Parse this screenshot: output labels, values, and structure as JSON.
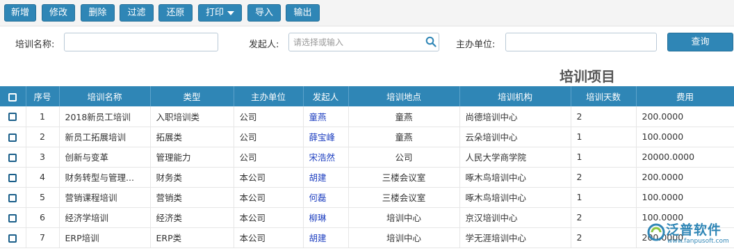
{
  "toolbar": {
    "buttons": [
      "新增",
      "修改",
      "删除",
      "过滤",
      "还原",
      "打印",
      "导入",
      "输出"
    ]
  },
  "filters": {
    "name_label": "培训名称:",
    "name_value": "",
    "initiator_label": "发起人:",
    "initiator_placeholder": "请选择或输入",
    "org_label": "主办单位:",
    "org_value": "",
    "query_label": "查询"
  },
  "title": "培训项目",
  "table": {
    "columns": [
      "序号",
      "培训名称",
      "类型",
      "主办单位",
      "发起人",
      "培训地点",
      "培训机构",
      "培训天数",
      "费用"
    ],
    "rows": [
      {
        "no": "1",
        "name": "2018新员工培训",
        "type": "入职培训类",
        "org": "公司",
        "initiator": "童燕",
        "place": "童燕",
        "agency": "尚德培训中心",
        "days": "2",
        "fee": "200.0000"
      },
      {
        "no": "2",
        "name": "新员工拓展培训",
        "type": "拓展类",
        "org": "公司",
        "initiator": "薛宝峰",
        "place": "童燕",
        "agency": "云朵培训中心",
        "days": "1",
        "fee": "100.0000"
      },
      {
        "no": "3",
        "name": "创新与变革",
        "type": "管理能力",
        "org": "公司",
        "initiator": "宋浩然",
        "place": "公司",
        "agency": "人民大学商学院",
        "days": "1",
        "fee": "20000.0000"
      },
      {
        "no": "4",
        "name": "财务转型与管理...",
        "type": "财务类",
        "org": "本公司",
        "initiator": "胡建",
        "place": "三楼会议室",
        "agency": "啄木鸟培训中心",
        "days": "2",
        "fee": "200.0000"
      },
      {
        "no": "5",
        "name": "营销课程培训",
        "type": "营销类",
        "org": "本公司",
        "initiator": "何磊",
        "place": "三楼会议室",
        "agency": "啄木鸟培训中心",
        "days": "1",
        "fee": "100.0000"
      },
      {
        "no": "6",
        "name": "经济学培训",
        "type": "经济类",
        "org": "本公司",
        "initiator": "柳琳",
        "place": "培训中心",
        "agency": "京汉培训中心",
        "days": "2",
        "fee": "100.0000"
      },
      {
        "no": "7",
        "name": "ERP培训",
        "type": "ERP类",
        "org": "本公司",
        "initiator": "胡建",
        "place": "培训中心",
        "agency": "学无涯培训中心",
        "days": "2",
        "fee": "200.0000"
      }
    ]
  },
  "logo": {
    "name": "泛普软件",
    "url": "www.fanpusoft.com"
  },
  "colors": {
    "accent": "#2f86b6",
    "link": "#1f40c0"
  }
}
